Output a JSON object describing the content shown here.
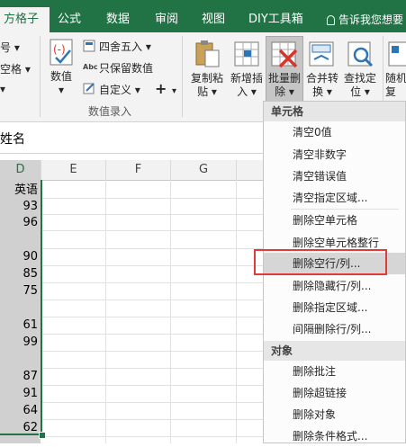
{
  "tabs": [
    {
      "label": "方格子",
      "active": true
    },
    {
      "label": "公式",
      "active": false
    },
    {
      "label": "数据",
      "active": false
    },
    {
      "label": "审阅",
      "active": false
    },
    {
      "label": "视图",
      "active": false
    },
    {
      "label": "DIY工具箱",
      "active": false
    }
  ],
  "tell_me": "告诉我您想要",
  "ribbon": {
    "left_partial": [
      "号 ▾",
      "空格 ▾",
      "▾"
    ],
    "numeric_button": "数值",
    "round_button": "四舍五入",
    "keep_value_button": "只保留数值",
    "custom_button": "自定义",
    "plus_button": "+",
    "group_label": "数值录入",
    "copy_paste": [
      "复制粘",
      "贴"
    ],
    "add_insert": [
      "新增插",
      "入"
    ],
    "batch_delete": [
      "批量删",
      "除"
    ],
    "merge_convert": [
      "合并转",
      "换"
    ],
    "find_locate": [
      "查找定",
      "位"
    ],
    "random_partial": [
      "随机",
      "复"
    ]
  },
  "formula_bar": {
    "name_partial": "姓名"
  },
  "grid": {
    "columns": [
      "D",
      "E",
      "F",
      "G"
    ],
    "selected_column": "D",
    "cells": [
      "英语",
      "93",
      "96",
      "",
      "90",
      "85",
      "75",
      "",
      "61",
      "99",
      "",
      "87",
      "91",
      "64",
      "62"
    ]
  },
  "menu": {
    "section1": "单元格",
    "items1": [
      "清空0值",
      "清空非数字",
      "清空错误值",
      "清空指定区域...",
      "删除空单元格",
      "删除空单元格整行",
      "删除空行/列...",
      "删除隐藏行/列...",
      "删除指定区域...",
      "间隔删除行/列..."
    ],
    "highlighted": "删除空行/列...",
    "section2": "对象",
    "items2": [
      "删除批注",
      "删除超链接",
      "删除对象",
      "删除条件格式..."
    ]
  },
  "colors": {
    "accent": "#217346",
    "highlight_box": "#e03a3a",
    "delete_x": "#d9342b"
  }
}
